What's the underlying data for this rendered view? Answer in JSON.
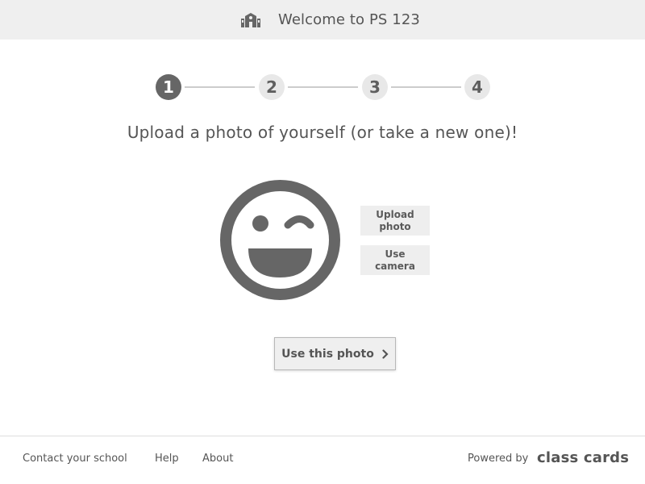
{
  "header": {
    "title": "Welcome to PS 123",
    "icon": "school-building-icon"
  },
  "stepper": {
    "steps": [
      "1",
      "2",
      "3",
      "4"
    ],
    "current_step": 1
  },
  "main": {
    "instruction": "Upload a photo of yourself (or take a new one)!",
    "avatar_icon": "winking-smiley-icon",
    "upload_label": "Upload\nphoto",
    "camera_label": "Use\ncamera",
    "use_photo_label": "Use this photo",
    "use_photo_icon": "chevron-right-icon"
  },
  "footer": {
    "links": [
      "Contact your school",
      "Help",
      "About"
    ],
    "powered_by": "Powered by",
    "brand": "class cards"
  },
  "colors": {
    "header_bg": "#efefef",
    "active_step": "#666666",
    "inactive_step": "#e8e8e8",
    "text": "#555555"
  }
}
